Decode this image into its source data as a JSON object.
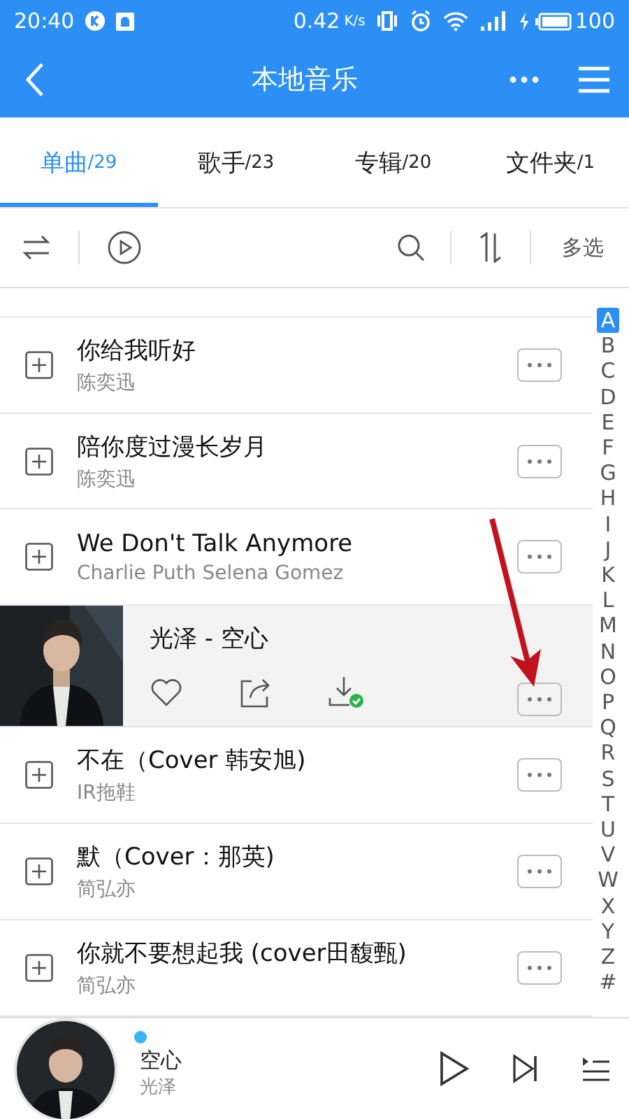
{
  "status_bar": {
    "time": "20:40",
    "speed": "0.42",
    "speed_unit": "K/s",
    "battery": "100"
  },
  "header": {
    "title": "本地音乐"
  },
  "tabs": [
    {
      "label": "单曲",
      "count": "/29",
      "selected": true
    },
    {
      "label": "歌手",
      "count": "/23",
      "selected": false
    },
    {
      "label": "专辑",
      "count": "/20",
      "selected": false
    },
    {
      "label": "文件夹",
      "count": "/1",
      "selected": false
    }
  ],
  "toolbar": {
    "multi_select": "多选"
  },
  "songs": [
    {
      "kind": "row",
      "title": "你给我听好",
      "artist": "陈奕迅"
    },
    {
      "kind": "row",
      "title": "陪你度过漫长岁月",
      "artist": "陈奕迅"
    },
    {
      "kind": "row",
      "title": "We Don't Talk Anymore",
      "artist": "Charlie Puth Selena Gomez"
    },
    {
      "kind": "expanded",
      "title": "光泽 - 空心",
      "downloaded": true
    },
    {
      "kind": "row",
      "title": "不在（Cover 韩安旭)",
      "artist": "IR拖鞋"
    },
    {
      "kind": "row",
      "title": "默（Cover：那英)",
      "artist": "简弘亦"
    },
    {
      "kind": "row",
      "title": "你就不要想起我 (cover田馥甄)",
      "artist": "简弘亦"
    }
  ],
  "index": [
    {
      "letter": "A",
      "selected": true
    },
    {
      "letter": "B",
      "selected": false
    },
    {
      "letter": "C",
      "selected": false
    },
    {
      "letter": "D",
      "selected": false
    },
    {
      "letter": "E",
      "selected": false
    },
    {
      "letter": "F",
      "selected": false
    },
    {
      "letter": "G",
      "selected": false
    },
    {
      "letter": "H",
      "selected": false
    },
    {
      "letter": "I",
      "selected": false
    },
    {
      "letter": "J",
      "selected": false
    },
    {
      "letter": "K",
      "selected": false
    },
    {
      "letter": "L",
      "selected": false
    },
    {
      "letter": "M",
      "selected": false
    },
    {
      "letter": "N",
      "selected": false
    },
    {
      "letter": "O",
      "selected": false
    },
    {
      "letter": "P",
      "selected": false
    },
    {
      "letter": "Q",
      "selected": false
    },
    {
      "letter": "R",
      "selected": false
    },
    {
      "letter": "S",
      "selected": false
    },
    {
      "letter": "T",
      "selected": false
    },
    {
      "letter": "U",
      "selected": false
    },
    {
      "letter": "V",
      "selected": false
    },
    {
      "letter": "W",
      "selected": false
    },
    {
      "letter": "X",
      "selected": false
    },
    {
      "letter": "Y",
      "selected": false
    },
    {
      "letter": "Z",
      "selected": false
    },
    {
      "letter": "#",
      "selected": false
    }
  ],
  "player": {
    "title": "空心",
    "artist": "光泽"
  }
}
